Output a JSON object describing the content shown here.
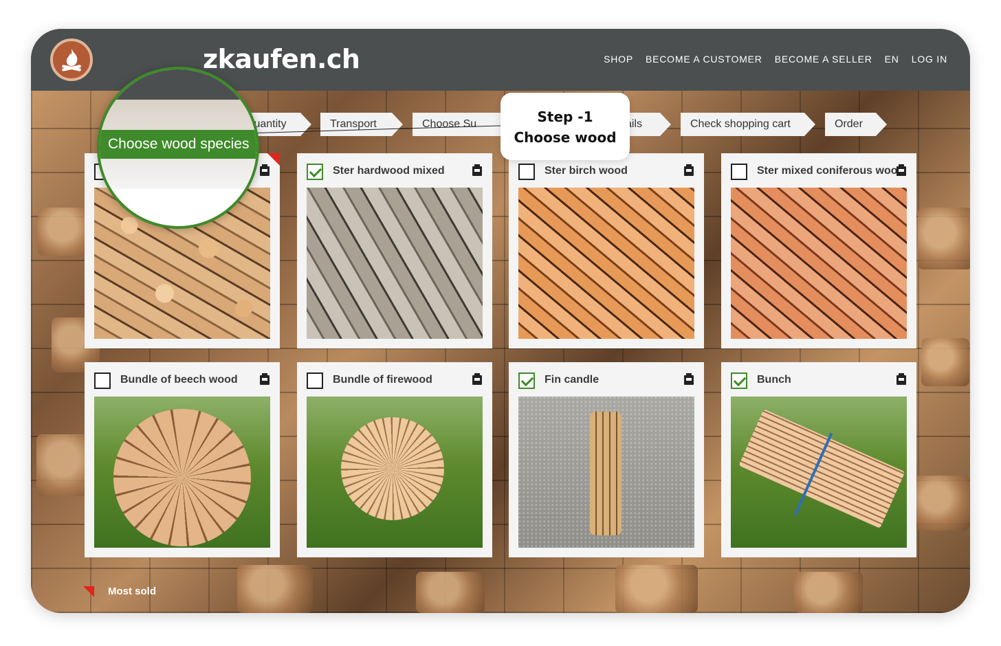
{
  "site": {
    "logo_text": "Holzkaufen.ch",
    "logo_partial": "zkaufen.ch"
  },
  "nav": [
    "SHOP",
    "BECOME A CUSTOMER",
    "BECOME A SELLER",
    "EN",
    "LOG IN"
  ],
  "steps": {
    "quantity": "Quantity",
    "transport": "Transport",
    "choose_supplier": "Choose Su",
    "contact_details": "act details",
    "check_cart": "Check shopping cart",
    "order": "Order"
  },
  "callout": {
    "line1": "Step -1",
    "line2": "Choose wood"
  },
  "magnifier": {
    "step_label": "Choose wood species"
  },
  "products": [
    {
      "title": "",
      "checked": false,
      "most_sold": true
    },
    {
      "title": "Ster hardwood mixed",
      "checked": true,
      "most_sold": false
    },
    {
      "title": "Ster birch wood",
      "checked": false,
      "most_sold": false
    },
    {
      "title": "Ster mixed coniferous wood",
      "checked": false,
      "most_sold": false
    },
    {
      "title": "Bundle of beech wood",
      "checked": false,
      "most_sold": false
    },
    {
      "title": "Bundle of firewood",
      "checked": false,
      "most_sold": false
    },
    {
      "title": "Fin candle",
      "checked": true,
      "most_sold": false
    },
    {
      "title": "Bunch",
      "checked": true,
      "most_sold": false
    }
  ],
  "legend": {
    "label": "Most sold",
    "color": "#e0261d"
  },
  "colors": {
    "header": "#4b4f4f",
    "accent_green": "#3f8a2a",
    "card": "#f4f4f4"
  }
}
